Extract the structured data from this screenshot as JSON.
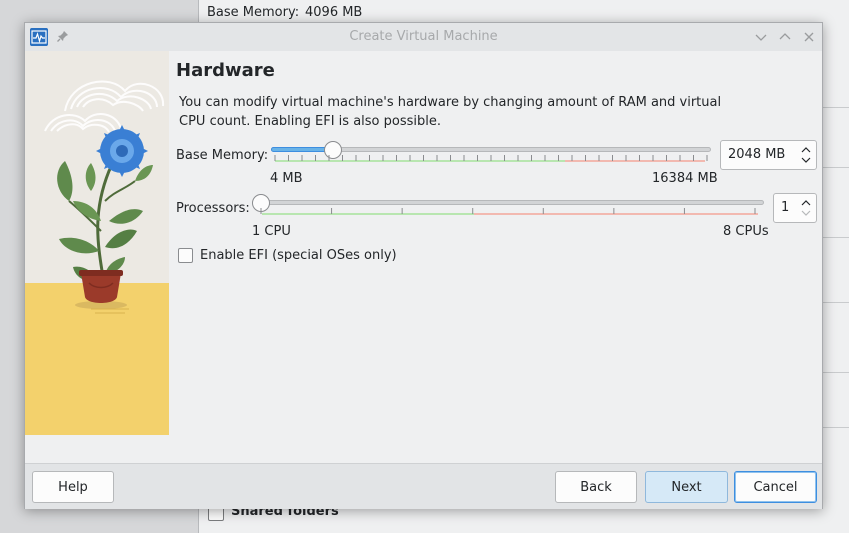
{
  "background": {
    "base_memory_label": "Base Memory:",
    "base_memory_value": "4096 MB",
    "shared_folders_label": "Shared folders"
  },
  "dialog": {
    "title": "Create Virtual Machine",
    "heading": "Hardware",
    "description": "You can modify virtual machine's hardware by changing amount of RAM and virtual CPU count. Enabling EFI is also possible.",
    "memory": {
      "label": "Base Memory:",
      "min_label": "4 MB",
      "max_label": "16384 MB",
      "value": "2048 MB",
      "value_mb": 2048,
      "min_mb": 4,
      "max_mb": 16384
    },
    "processors": {
      "label": "Processors:",
      "min_label": "1 CPU",
      "max_label": "8 CPUs",
      "value": "1",
      "min": 1,
      "max": 8
    },
    "efi": {
      "label": "Enable EFI (special OSes only)",
      "checked": false
    },
    "buttons": {
      "help": "Help",
      "back": "Back",
      "next": "Next",
      "cancel": "Cancel"
    }
  },
  "colors": {
    "accent": "#3d8ee0",
    "slider_fill": "#69b3e7",
    "safe_zone": "#b8e6b0",
    "warn_zone": "#f2b9b0",
    "illustration_floor": "#f3d16c",
    "flower": "#3a7fd4"
  },
  "icons": [
    "virtualbox-app-icon",
    "pin-icon",
    "minimize-icon",
    "maximize-icon",
    "close-icon",
    "chevron-up-icon",
    "chevron-down-icon"
  ]
}
